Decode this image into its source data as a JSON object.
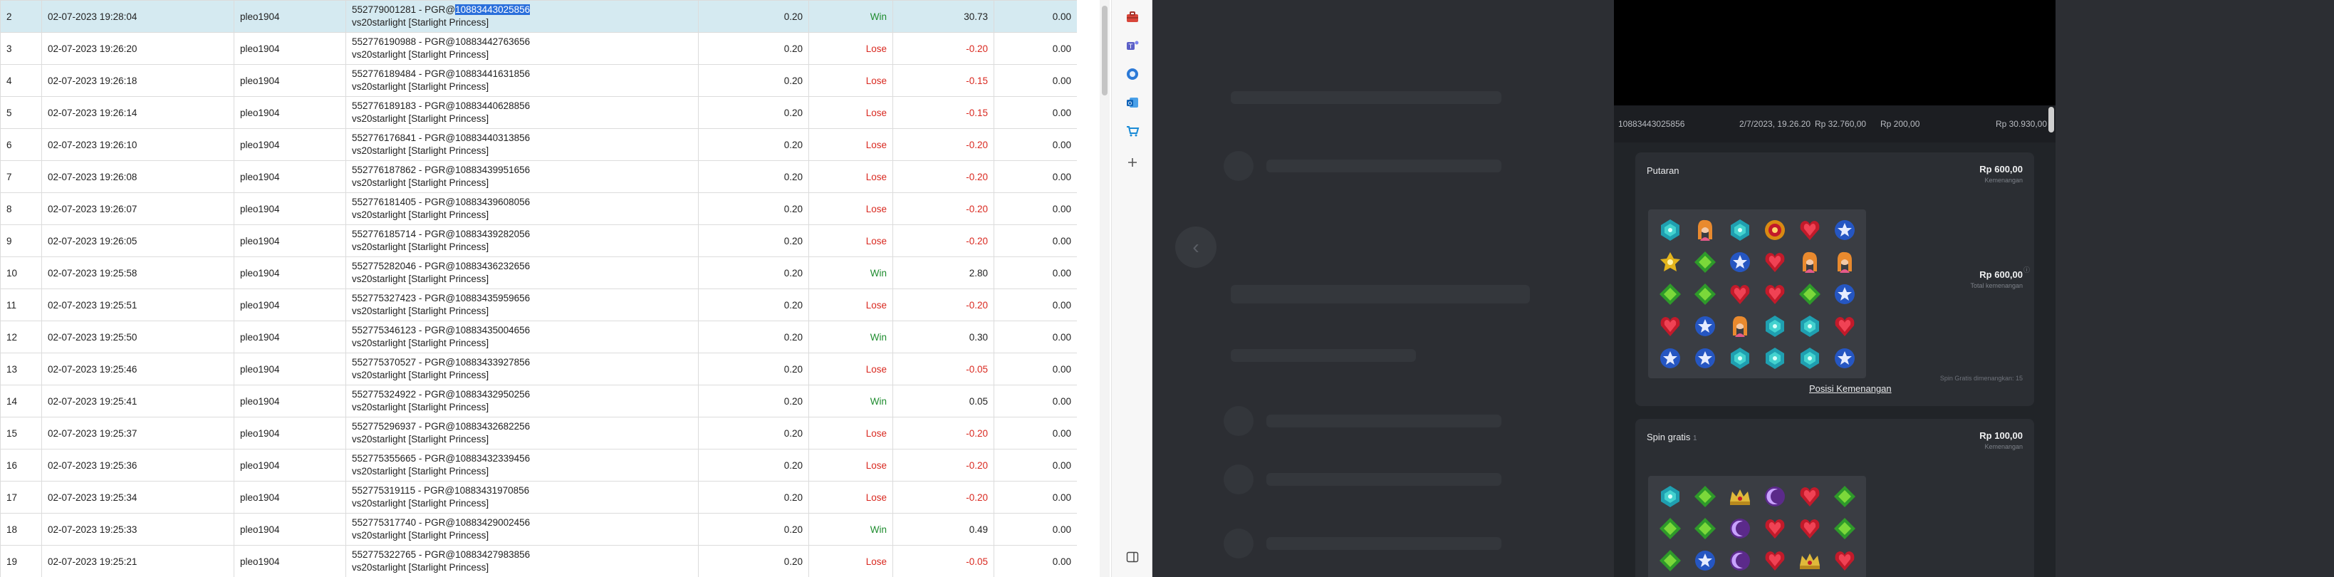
{
  "rows": [
    {
      "no": "2",
      "datetime": "02-07-2023 19:28:04",
      "user": "pleo1904",
      "ref_prefix": "552779001281 - PGR@",
      "ref_id": "10883443025856",
      "game": "vs20starlight [Starlight Princess]",
      "bet": "0.20",
      "result": "Win",
      "win": "30.73",
      "balance": "0.00",
      "selected": true
    },
    {
      "no": "3",
      "datetime": "02-07-2023 19:26:20",
      "user": "pleo1904",
      "ref_prefix": "552776190988 - PGR@",
      "ref_id": "10883442763656",
      "game": "vs20starlight [Starlight Princess]",
      "bet": "0.20",
      "result": "Lose",
      "win": "-0.20",
      "balance": "0.00"
    },
    {
      "no": "4",
      "datetime": "02-07-2023 19:26:18",
      "user": "pleo1904",
      "ref_prefix": "552776189484 - PGR@",
      "ref_id": "10883441631856",
      "game": "vs20starlight [Starlight Princess]",
      "bet": "0.20",
      "result": "Lose",
      "win": "-0.15",
      "balance": "0.00"
    },
    {
      "no": "5",
      "datetime": "02-07-2023 19:26:14",
      "user": "pleo1904",
      "ref_prefix": "552776189183 - PGR@",
      "ref_id": "10883440628856",
      "game": "vs20starlight [Starlight Princess]",
      "bet": "0.20",
      "result": "Lose",
      "win": "-0.15",
      "balance": "0.00"
    },
    {
      "no": "6",
      "datetime": "02-07-2023 19:26:10",
      "user": "pleo1904",
      "ref_prefix": "552776176841 - PGR@",
      "ref_id": "10883440313856",
      "game": "vs20starlight [Starlight Princess]",
      "bet": "0.20",
      "result": "Lose",
      "win": "-0.20",
      "balance": "0.00"
    },
    {
      "no": "7",
      "datetime": "02-07-2023 19:26:08",
      "user": "pleo1904",
      "ref_prefix": "552776187862 - PGR@",
      "ref_id": "10883439951656",
      "game": "vs20starlight [Starlight Princess]",
      "bet": "0.20",
      "result": "Lose",
      "win": "-0.20",
      "balance": "0.00"
    },
    {
      "no": "8",
      "datetime": "02-07-2023 19:26:07",
      "user": "pleo1904",
      "ref_prefix": "552776181405 - PGR@",
      "ref_id": "10883439608056",
      "game": "vs20starlight [Starlight Princess]",
      "bet": "0.20",
      "result": "Lose",
      "win": "-0.20",
      "balance": "0.00"
    },
    {
      "no": "9",
      "datetime": "02-07-2023 19:26:05",
      "user": "pleo1904",
      "ref_prefix": "552776185714 - PGR@",
      "ref_id": "10883439282056",
      "game": "vs20starlight [Starlight Princess]",
      "bet": "0.20",
      "result": "Lose",
      "win": "-0.20",
      "balance": "0.00"
    },
    {
      "no": "10",
      "datetime": "02-07-2023 19:25:58",
      "user": "pleo1904",
      "ref_prefix": "552775282046 - PGR@",
      "ref_id": "10883436232656",
      "game": "vs20starlight [Starlight Princess]",
      "bet": "0.20",
      "result": "Win",
      "win": "2.80",
      "balance": "0.00"
    },
    {
      "no": "11",
      "datetime": "02-07-2023 19:25:51",
      "user": "pleo1904",
      "ref_prefix": "552775327423 - PGR@",
      "ref_id": "10883435959656",
      "game": "vs20starlight [Starlight Princess]",
      "bet": "0.20",
      "result": "Lose",
      "win": "-0.20",
      "balance": "0.00"
    },
    {
      "no": "12",
      "datetime": "02-07-2023 19:25:50",
      "user": "pleo1904",
      "ref_prefix": "552775346123 - PGR@",
      "ref_id": "10883435004656",
      "game": "vs20starlight [Starlight Princess]",
      "bet": "0.20",
      "result": "Win",
      "win": "0.30",
      "balance": "0.00"
    },
    {
      "no": "13",
      "datetime": "02-07-2023 19:25:46",
      "user": "pleo1904",
      "ref_prefix": "552775370527 - PGR@",
      "ref_id": "10883433927856",
      "game": "vs20starlight [Starlight Princess]",
      "bet": "0.20",
      "result": "Lose",
      "win": "-0.05",
      "balance": "0.00"
    },
    {
      "no": "14",
      "datetime": "02-07-2023 19:25:41",
      "user": "pleo1904",
      "ref_prefix": "552775324922 - PGR@",
      "ref_id": "10883432950256",
      "game": "vs20starlight [Starlight Princess]",
      "bet": "0.20",
      "result": "Win",
      "win": "0.05",
      "balance": "0.00"
    },
    {
      "no": "15",
      "datetime": "02-07-2023 19:25:37",
      "user": "pleo1904",
      "ref_prefix": "552775296937 - PGR@",
      "ref_id": "10883432682256",
      "game": "vs20starlight [Starlight Princess]",
      "bet": "0.20",
      "result": "Lose",
      "win": "-0.20",
      "balance": "0.00"
    },
    {
      "no": "16",
      "datetime": "02-07-2023 19:25:36",
      "user": "pleo1904",
      "ref_prefix": "552775355665 - PGR@",
      "ref_id": "10883432339456",
      "game": "vs20starlight [Starlight Princess]",
      "bet": "0.20",
      "result": "Lose",
      "win": "-0.20",
      "balance": "0.00"
    },
    {
      "no": "17",
      "datetime": "02-07-2023 19:25:34",
      "user": "pleo1904",
      "ref_prefix": "552775319115 - PGR@",
      "ref_id": "10883431970856",
      "game": "vs20starlight [Starlight Princess]",
      "bet": "0.20",
      "result": "Lose",
      "win": "-0.20",
      "balance": "0.00"
    },
    {
      "no": "18",
      "datetime": "02-07-2023 19:25:33",
      "user": "pleo1904",
      "ref_prefix": "552775317740 - PGR@",
      "ref_id": "10883429002456",
      "game": "vs20starlight [Starlight Princess]",
      "bet": "0.20",
      "result": "Win",
      "win": "0.49",
      "balance": "0.00"
    },
    {
      "no": "19",
      "datetime": "02-07-2023 19:25:21",
      "user": "pleo1904",
      "ref_prefix": "552775322765 - PGR@",
      "ref_id": "10883427983856",
      "game": "vs20starlight [Starlight Princess]",
      "bet": "0.20",
      "result": "Lose",
      "win": "-0.05",
      "balance": "0.00"
    }
  ],
  "sidebar_icons": [
    "toolbox-icon",
    "teams-icon",
    "copilot-icon",
    "outlook-icon",
    "shopping-cart-icon",
    "add-icon",
    "sidebar-toggle-icon"
  ],
  "detail": {
    "summary": {
      "round_id": "10883443025856",
      "datetime": "2/7/2023, 19.26.20",
      "bet": "Rp 32.760,00",
      "win": "Rp 200,00",
      "balance": "Rp 30.930,00"
    },
    "spin": {
      "title": "Putaran",
      "amount": "Rp 600,00",
      "amount_sub": "Kemenangan",
      "total_amount": "Rp 600,00",
      "total_sub": "Total kemenangan",
      "free_spin_note": "Spin Gratis dimenangkan: 15",
      "positions_link": "Posisi Kemenangan",
      "grid": [
        [
          "teal",
          "princess",
          "teal",
          "sun",
          "red",
          "blue"
        ],
        [
          "yellow",
          "green",
          "blue",
          "red",
          "princess",
          "princess"
        ],
        [
          "green",
          "green",
          "red",
          "red",
          "green",
          "blue"
        ],
        [
          "red",
          "blue",
          "princess",
          "teal",
          "teal",
          "red"
        ],
        [
          "blue",
          "blue",
          "teal",
          "teal",
          "teal",
          "blue"
        ]
      ]
    },
    "free_spin": {
      "title": "Spin gratis",
      "index": "1",
      "amount": "Rp 100,00",
      "amount_sub": "Kemenangan",
      "grid": [
        [
          "teal",
          "green",
          "crown",
          "moon",
          "red",
          "green"
        ],
        [
          "green",
          "green",
          "moon",
          "red",
          "red",
          "green"
        ],
        [
          "green",
          "blue",
          "moon",
          "red",
          "crown",
          "red"
        ]
      ]
    }
  },
  "colors": {
    "win": "#1f8c2f",
    "lose": "#d9281f",
    "selected_row": "#d5eaf1",
    "highlight": "#2a6fdb",
    "dark_bg": "#2c2e33",
    "card_bg": "#2b2e33"
  }
}
